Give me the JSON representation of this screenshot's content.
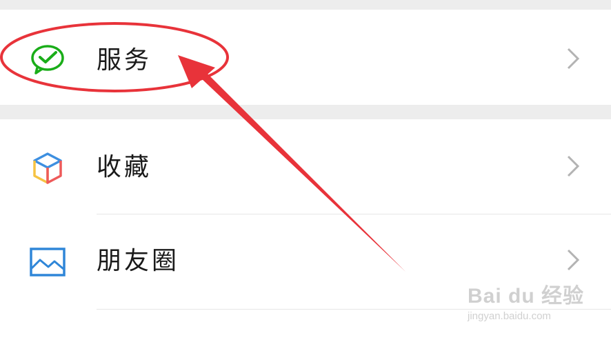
{
  "menu": {
    "items": [
      {
        "label": "服务",
        "icon": "wechat-pay-icon"
      },
      {
        "label": "收藏",
        "icon": "favorites-cube-icon"
      },
      {
        "label": "朋友圈",
        "icon": "moments-image-icon"
      }
    ]
  },
  "watermark": {
    "logo": "Bai du 经验",
    "url": "jingyan.baidu.com"
  },
  "colors": {
    "annotation": "#e8333a",
    "pay_green": "#1aad19",
    "moments_blue": "#2f86d8"
  }
}
